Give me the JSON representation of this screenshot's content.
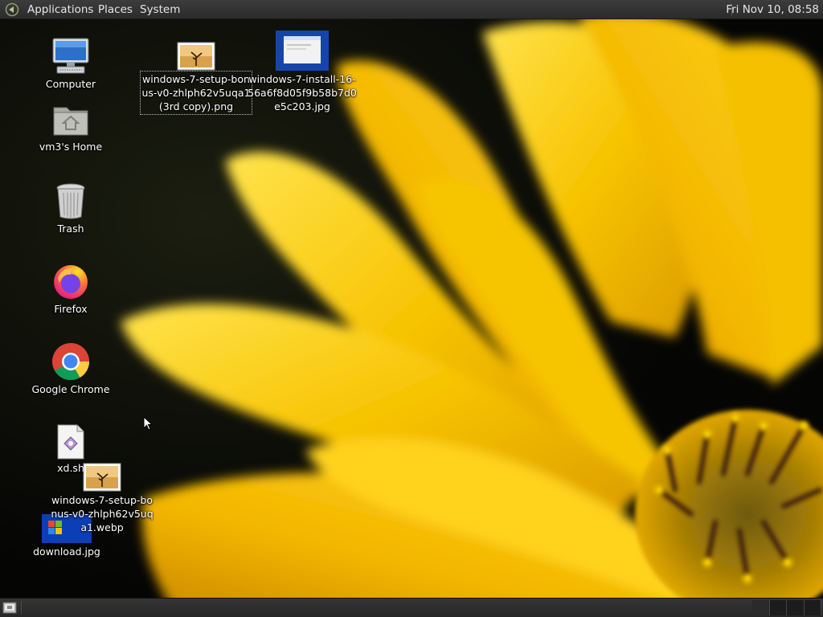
{
  "top_panel": {
    "menus": [
      "Applications",
      "Places",
      "System"
    ],
    "clock": "Fri Nov 10, 08:58"
  },
  "desktop": {
    "icons": [
      {
        "label": "Computer",
        "icon": "computer-icon"
      },
      {
        "label": "vm3's Home",
        "icon": "home-folder-icon"
      },
      {
        "label": "Trash",
        "icon": "trash-icon"
      },
      {
        "label": "Firefox",
        "icon": "firefox-icon"
      },
      {
        "label": "Google Chrome",
        "icon": "chrome-icon"
      },
      {
        "label": "xd.sh",
        "icon": "script-file-icon"
      },
      {
        "label": "windows-7-setup-bonus-v0-zhlph62v5uqa1.webp",
        "icon": "image-file-icon"
      },
      {
        "label": "download.jpg",
        "icon": "image-file-icon"
      },
      {
        "label": "windows-7-setup-bonus-v0-zhlph62v5uqa1 (3rd copy).png",
        "icon": "image-file-icon"
      },
      {
        "label": "windows-7-install-16-56a6f8d05f9b58b7d0e5c203.jpg",
        "icon": "image-file-icon"
      }
    ]
  },
  "colors": {
    "panel": "#2b2b2b",
    "panel_text": "#e6e6e6",
    "petal": "#f5c400",
    "background": "#0a0a08"
  }
}
